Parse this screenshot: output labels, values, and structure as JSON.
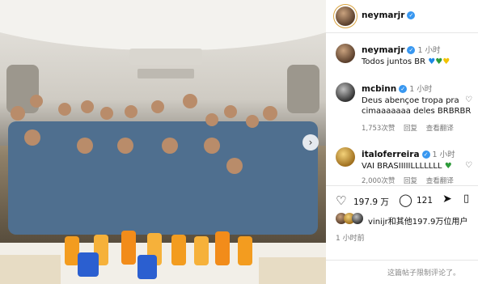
{
  "header": {
    "username": "neymarjr"
  },
  "caption": {
    "username": "neymarjr",
    "time": "1 小时",
    "text": "Todos juntos BR",
    "hearts": [
      "#1e88e5",
      "#2e9b3a",
      "#f2c200"
    ]
  },
  "comments": [
    {
      "username": "mcbinn",
      "time": "1 小时",
      "line1": "Deus abençoe tropa pra",
      "line2": "cimaaaaaaa deles BRBRBR",
      "likes": "1,753次赞",
      "reply": "回复",
      "translate": "查看翻译"
    },
    {
      "username": "italoferreira",
      "time": "1 小时",
      "line1": "VAI BRASIIIIILLLLLLL",
      "likes": "2,000次赞",
      "reply": "回复",
      "translate": "查看翻译",
      "heart_color": "#2e9b3a"
    }
  ],
  "actions": {
    "likes_count": "197.9 万",
    "comments_count": "121",
    "liked_by": "vinijr和其他197.9万位用户",
    "posted": "1 小时前"
  },
  "footer": {
    "text": "这篇帖子限制评论了。"
  },
  "icons": [
    "verified-icon",
    "heart-icon",
    "comment-icon",
    "share-icon",
    "bookmark-icon",
    "chevron-right-icon"
  ]
}
